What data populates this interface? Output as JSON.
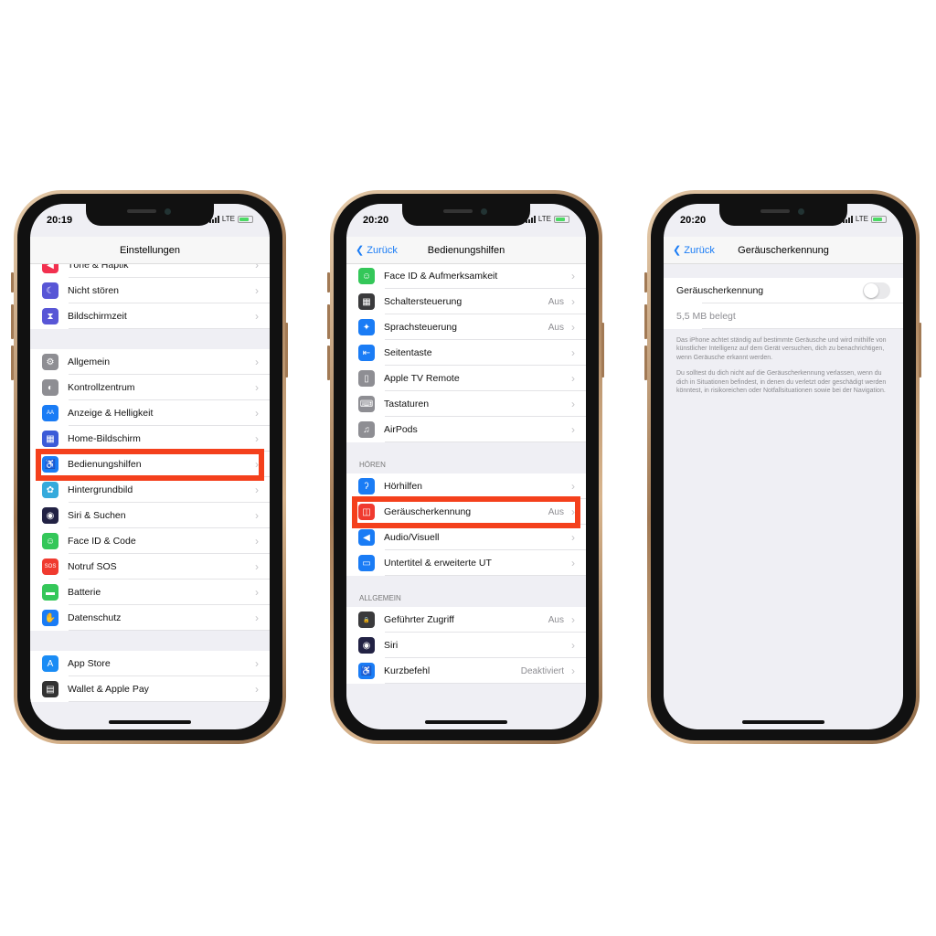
{
  "colors": {
    "highlight": "#f4401c",
    "link": "#1a7cf5"
  },
  "phones": [
    {
      "time": "20:19",
      "network": "LTE",
      "title": "Einstellungen",
      "back": "",
      "sections": [
        {
          "rows": [
            {
              "label": "Töne & Haptik",
              "icon": "speaker-icon",
              "color": "#f2304f",
              "glyph": "◀"
            },
            {
              "label": "Nicht stören",
              "icon": "moon-icon",
              "color": "#5856d6",
              "glyph": "☾"
            },
            {
              "label": "Bildschirmzeit",
              "icon": "hourglass-icon",
              "color": "#5856d6",
              "glyph": "⧗"
            }
          ]
        },
        {
          "rows": [
            {
              "label": "Allgemein",
              "icon": "gear-icon",
              "color": "#8e8e93",
              "glyph": "⚙"
            },
            {
              "label": "Kontrollzentrum",
              "icon": "switches-icon",
              "color": "#8e8e93",
              "glyph": "◐"
            },
            {
              "label": "Anzeige & Helligkeit",
              "icon": "text-size-icon",
              "color": "#1a7cf5",
              "glyph": "AA"
            },
            {
              "label": "Home-Bildschirm",
              "icon": "grid-icon",
              "color": "#3c5bd8",
              "glyph": "▦"
            },
            {
              "label": "Bedienungshilfen",
              "icon": "accessibility-icon",
              "color": "#1a7cf5",
              "glyph": "♿",
              "highlighted": true
            },
            {
              "label": "Hintergrundbild",
              "icon": "flower-icon",
              "color": "#35aadc",
              "glyph": "✿"
            },
            {
              "label": "Siri & Suchen",
              "icon": "siri-icon",
              "color": "#222244",
              "glyph": "◉"
            },
            {
              "label": "Face ID & Code",
              "icon": "face-id-icon",
              "color": "#34c759",
              "glyph": "☺"
            },
            {
              "label": "Notruf SOS",
              "icon": "sos-icon",
              "color": "#f03a2f",
              "glyph": "SOS"
            },
            {
              "label": "Batterie",
              "icon": "battery-icon",
              "color": "#34c759",
              "glyph": "▬"
            },
            {
              "label": "Datenschutz",
              "icon": "hand-icon",
              "color": "#1a7cf5",
              "glyph": "✋"
            }
          ]
        },
        {
          "rows": [
            {
              "label": "App Store",
              "icon": "app-store-icon",
              "color": "#1a8cf5",
              "glyph": "A"
            },
            {
              "label": "Wallet & Apple Pay",
              "icon": "wallet-icon",
              "color": "#333",
              "glyph": "▤"
            }
          ]
        }
      ]
    },
    {
      "time": "20:20",
      "network": "LTE",
      "title": "Bedienungshilfen",
      "back": "Zurück",
      "sections": [
        {
          "rows": [
            {
              "label": "Face ID & Aufmerksamkeit",
              "icon": "face-id-icon",
              "color": "#34c759",
              "glyph": "☺"
            },
            {
              "label": "Schaltersteuerung",
              "value": "Aus",
              "icon": "switch-control-icon",
              "color": "#3a3a3c",
              "glyph": "▦"
            },
            {
              "label": "Sprachsteuerung",
              "value": "Aus",
              "icon": "voice-control-icon",
              "color": "#1a7cf5",
              "glyph": "✦"
            },
            {
              "label": "Seitentaste",
              "icon": "side-button-icon",
              "color": "#1a7cf5",
              "glyph": "⇤"
            },
            {
              "label": "Apple TV Remote",
              "icon": "remote-icon",
              "color": "#8e8e93",
              "glyph": "▯"
            },
            {
              "label": "Tastaturen",
              "icon": "keyboard-icon",
              "color": "#8e8e93",
              "glyph": "⌨"
            },
            {
              "label": "AirPods",
              "icon": "airpods-icon",
              "color": "#8e8e93",
              "glyph": "♫"
            }
          ]
        },
        {
          "header": "HÖREN",
          "rows": [
            {
              "label": "Hörhilfen",
              "icon": "ear-icon",
              "color": "#1a7cf5",
              "glyph": "ʔ"
            },
            {
              "label": "Geräuscherkennung",
              "value": "Aus",
              "icon": "sound-recognition-icon",
              "color": "#f03a2f",
              "glyph": "◫",
              "highlighted": true
            },
            {
              "label": "Audio/Visuell",
              "icon": "speaker-icon",
              "color": "#1a7cf5",
              "glyph": "◀"
            },
            {
              "label": "Untertitel & erweiterte UT",
              "icon": "subtitles-icon",
              "color": "#1a7cf5",
              "glyph": "▭"
            }
          ]
        },
        {
          "header": "ALLGEMEIN",
          "rows": [
            {
              "label": "Geführter Zugriff",
              "value": "Aus",
              "icon": "lock-icon",
              "color": "#3a3a3c",
              "glyph": "🔒"
            },
            {
              "label": "Siri",
              "icon": "siri-icon",
              "color": "#222244",
              "glyph": "◉"
            },
            {
              "label": "Kurzbefehl",
              "value": "Deaktiviert",
              "icon": "accessibility-icon",
              "color": "#1a7cf5",
              "glyph": "♿"
            }
          ]
        }
      ]
    },
    {
      "time": "20:20",
      "network": "LTE",
      "title": "Geräuscherkennung",
      "back": "Zurück",
      "toggle_label": "Geräuscherkennung",
      "toggle_on": false,
      "storage": "5,5 MB belegt",
      "footer": [
        "Das iPhone achtet ständig auf bestimmte Geräusche und wird mithilfe von künstlicher Intelligenz auf dem Gerät versuchen, dich zu benachrichtigen, wenn Geräusche erkannt werden.",
        "Du solltest du dich nicht auf die Geräuscherkennung verlassen, wenn du dich in Situationen befindest, in denen du verletzt oder geschädigt werden könntest, in risikoreichen oder Notfallsituationen sowie bei der Navigation."
      ]
    }
  ]
}
